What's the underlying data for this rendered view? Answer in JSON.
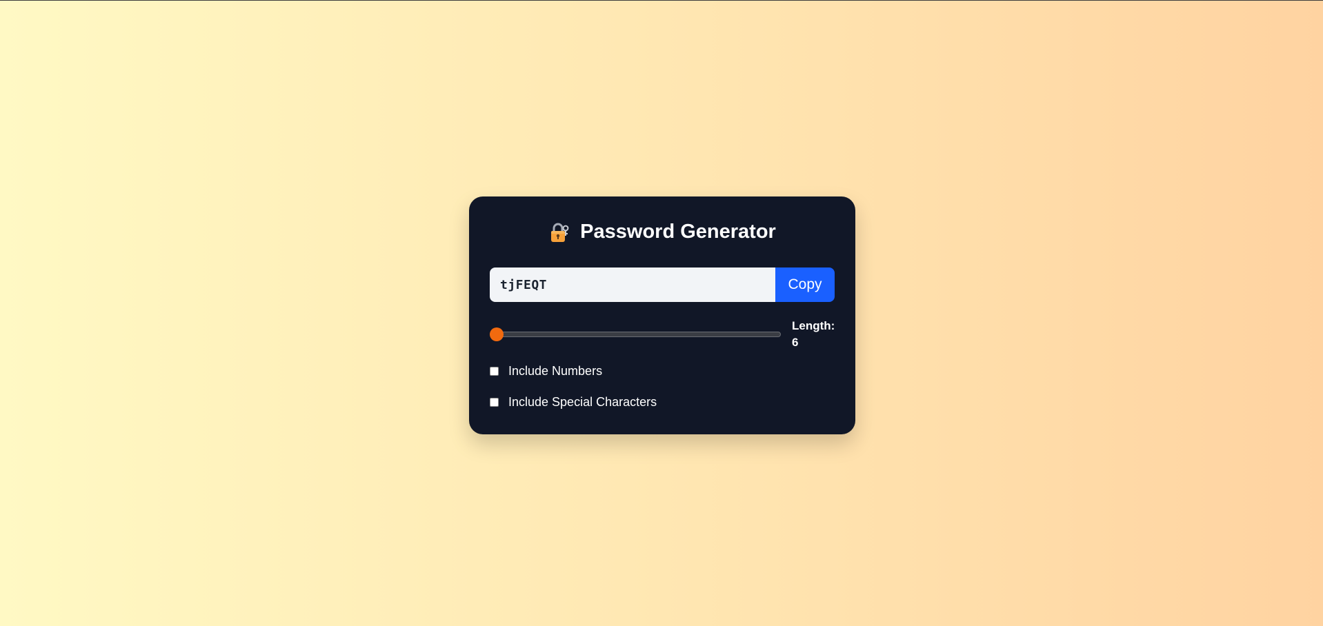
{
  "app": {
    "title": "Password Generator",
    "icon": "lock-with-key-icon"
  },
  "password": {
    "value": "tjFEQT",
    "copy_label": "Copy"
  },
  "length": {
    "label": "Length:",
    "value": "6",
    "slider_fraction": 0.0
  },
  "options": [
    {
      "label": "Include Numbers",
      "checked": false
    },
    {
      "label": "Include Special Characters",
      "checked": false
    }
  ],
  "colors": {
    "accent_button": "#1a60ff",
    "slider_thumb": "#f26a0f",
    "card_background": "#111727"
  }
}
